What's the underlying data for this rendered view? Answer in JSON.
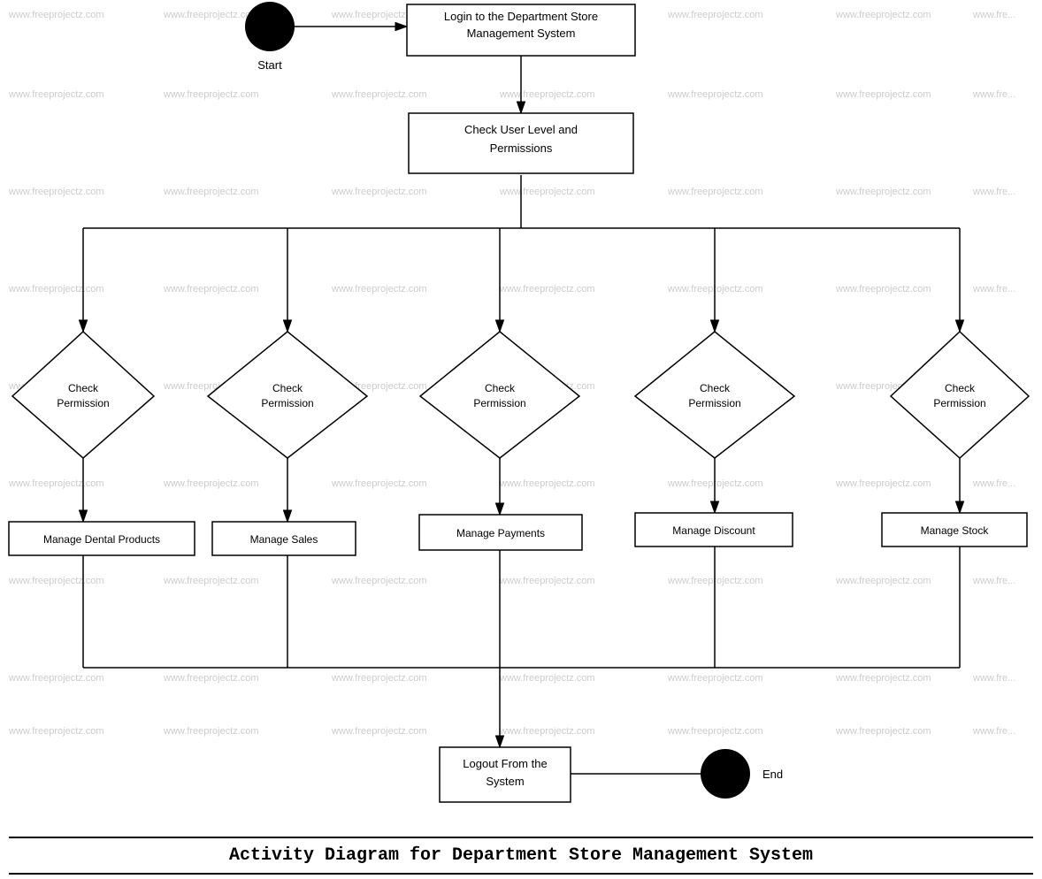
{
  "diagram": {
    "title": "Activity Diagram for Department Store Management System",
    "watermark_text": "www.freeprojectz.com",
    "nodes": {
      "start_label": "Start",
      "login": "Login to the Department Store Management System",
      "check_user_level": "Check User Level and Permissions",
      "check_perm1": "Check Permission",
      "check_perm2": "Check Permission",
      "check_perm3": "Check Permission",
      "check_perm4": "Check Permission",
      "check_perm5": "Check Permission",
      "manage_dental": "Manage Dental Products",
      "manage_sales": "Manage Sales",
      "manage_payments": "Manage Payments",
      "manage_discount": "Manage Discount",
      "manage_stock": "Manage Stock",
      "logout": "Logout From the System",
      "end_label": "End"
    }
  }
}
